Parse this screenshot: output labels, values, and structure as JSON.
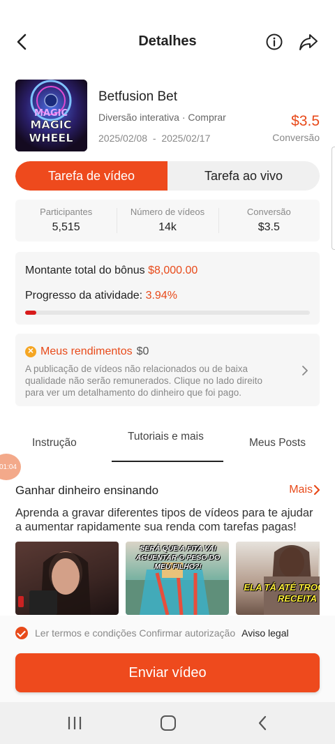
{
  "header": {
    "title": "Detalhes"
  },
  "game": {
    "name": "Betfusion Bet",
    "categories": "Diversão interativa · Comprar",
    "date_start": "2025/02/08",
    "date_sep": "-",
    "date_end": "2025/02/17",
    "price": "$3.5",
    "price_label": "Conversão",
    "thumb_text_1": "MAGIC",
    "thumb_text_2": "MAGIC",
    "thumb_text_3": "WHEEL"
  },
  "task_tabs": {
    "video": "Tarefa de vídeo",
    "live": "Tarefa ao vivo"
  },
  "stats": [
    {
      "label": "Participantes",
      "value": "5,515"
    },
    {
      "label": "Número de vídeos",
      "value": "14k"
    },
    {
      "label": "Conversão",
      "value": "$3.5"
    }
  ],
  "bonus": {
    "total_label": "Montante total do bônus",
    "total_value": "$8,000.00",
    "progress_label": "Progresso da atividade:",
    "progress_value": "3.94%",
    "progress_fraction": 0.0394
  },
  "earnings": {
    "title": "Meus rendimentos",
    "amount": "$0",
    "description": "A publicação de vídeos não relacionados ou de baixa qualidade não serão remunerados. Clique no lado direito para ver um detalhamento do dinheiro que foi pago."
  },
  "content_tabs": {
    "tab1": "Instrução",
    "tab2": "Tutoriais e mais",
    "tab3": "Meus Posts"
  },
  "float_badge": "01:04",
  "tutorial": {
    "title": "Ganhar dinheiro ensinando",
    "more": "Mais",
    "description": "Aprenda a gravar diferentes tipos de vídeos para te ajudar a aumentar rapidamente sua renda com tarefas pagas!",
    "caption_2": "SERÁ QUE A FITA VAI AGUENTAR O PESO DO MEU FILHO?!",
    "caption_3": "ELA TÁ ATÉ TROCANDO RECEITA"
  },
  "footer": {
    "terms": "Ler termos e condições Confirmar autorização",
    "legal": "Aviso legal",
    "submit": "Enviar vídeo"
  },
  "colors": {
    "accent": "#ee4a1d",
    "price": "#e84a1a",
    "progress": "#d81b1b"
  }
}
